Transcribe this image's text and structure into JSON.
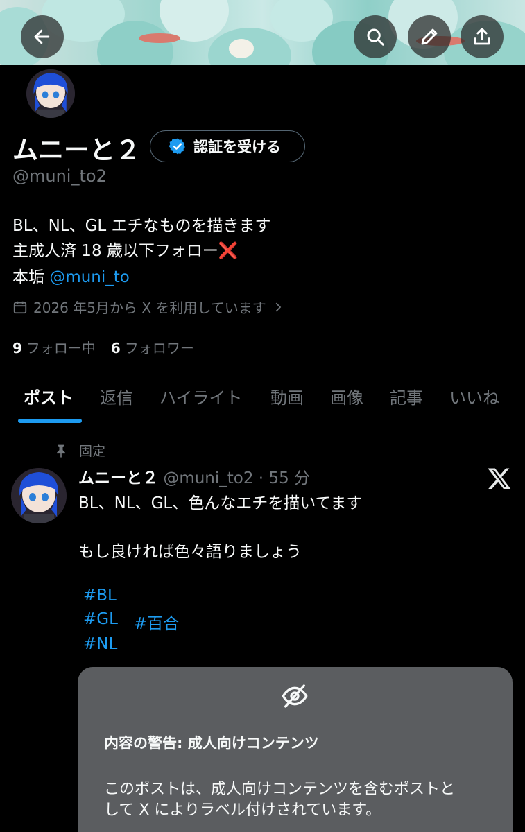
{
  "profile": {
    "name": "ムニーと２",
    "verify_label": "認証を受ける",
    "handle": "@muni_to2",
    "bio_line1": "BL、NL、GL エチなものを描きます",
    "bio_line2": "主成人済 18 歳以下フォロー",
    "bio_line2_emoji": "❌",
    "bio_line3_prefix": "本垢 ",
    "bio_line3_link": "@muni_to",
    "joined": "2026 年5月から X を利用しています",
    "following_count": "9",
    "following_label": "フォロー中",
    "followers_count": "6",
    "followers_label": "フォロワー"
  },
  "tabs": [
    {
      "label": "ポスト"
    },
    {
      "label": "返信"
    },
    {
      "label": "ハイライト"
    },
    {
      "label": "動画"
    },
    {
      "label": "画像"
    },
    {
      "label": "記事"
    },
    {
      "label": "いいね"
    }
  ],
  "post": {
    "pinned_label": "固定",
    "author_name": "ムニーと２",
    "author_handle": "@muni_to2",
    "time": "55 分",
    "line1": "BL、NL、GL、色んなエチを描いてます",
    "line2": "もし良ければ色々語りましょう",
    "hashtags": [
      "#BL",
      "#GL",
      "#百合",
      "#NL"
    ]
  },
  "warning": {
    "title": "内容の警告: 成人向けコンテンツ",
    "body_line1": "このポストは、成人向けコンテンツを含むポストと",
    "body_line2": "して X によりラベル付けされています。"
  },
  "icons": [
    "back-arrow-icon",
    "search-icon",
    "pencil-icon",
    "share-icon",
    "verified-badge-icon",
    "calendar-icon",
    "chevron-right-icon",
    "pin-icon",
    "x-logo-icon",
    "eye-slash-icon"
  ],
  "colors": {
    "accent": "#1d9bf0",
    "muted": "#71767b",
    "text": "#f7f9f9",
    "background": "#000000",
    "warning_bg": "#5b5d60"
  }
}
